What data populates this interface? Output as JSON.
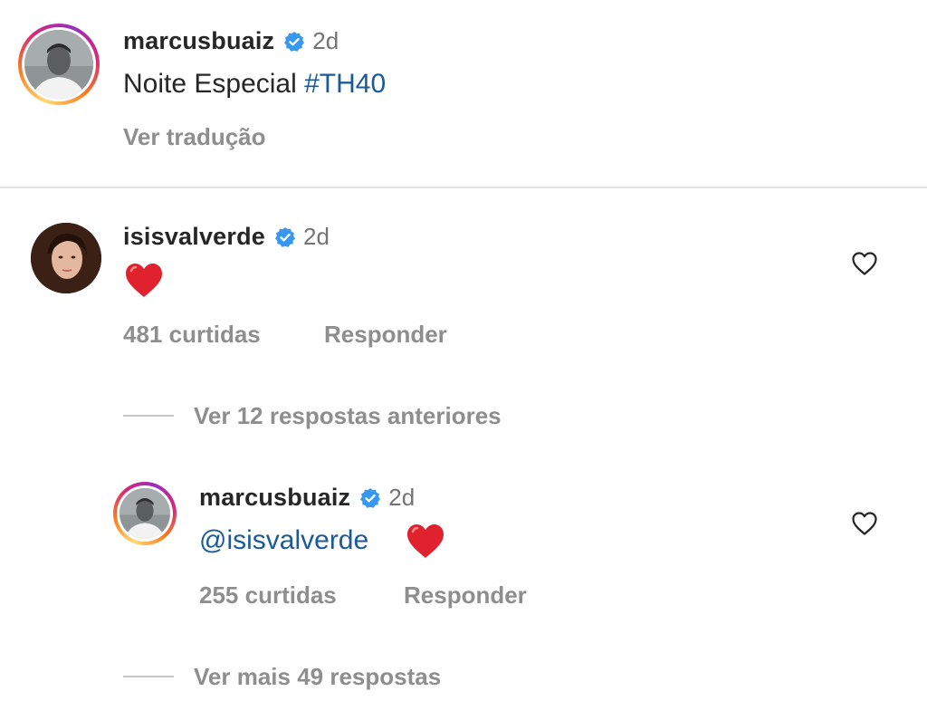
{
  "caption": {
    "username": "marcusbuaiz",
    "time": "2d",
    "text": "Noite Especial ",
    "hashtag": "#TH40",
    "translate_label": "Ver tradução"
  },
  "comment": {
    "username": "isisvalverde",
    "time": "2d",
    "text_icon": "red-heart-emoji",
    "likes": "481 curtidas",
    "reply_label": "Responder",
    "view_previous_replies": "Ver 12 respostas anteriores"
  },
  "reply": {
    "username": "marcusbuaiz",
    "time": "2d",
    "mention": "@isisvalverde",
    "text_icon": "red-heart-emoji",
    "likes": "255 curtidas",
    "reply_label": "Responder",
    "view_more_replies": "Ver mais 49 respostas"
  },
  "colors": {
    "verified": "#3897f0",
    "link": "#1a5a96",
    "heart": "#e0212e",
    "muted": "#8e8e8e"
  }
}
